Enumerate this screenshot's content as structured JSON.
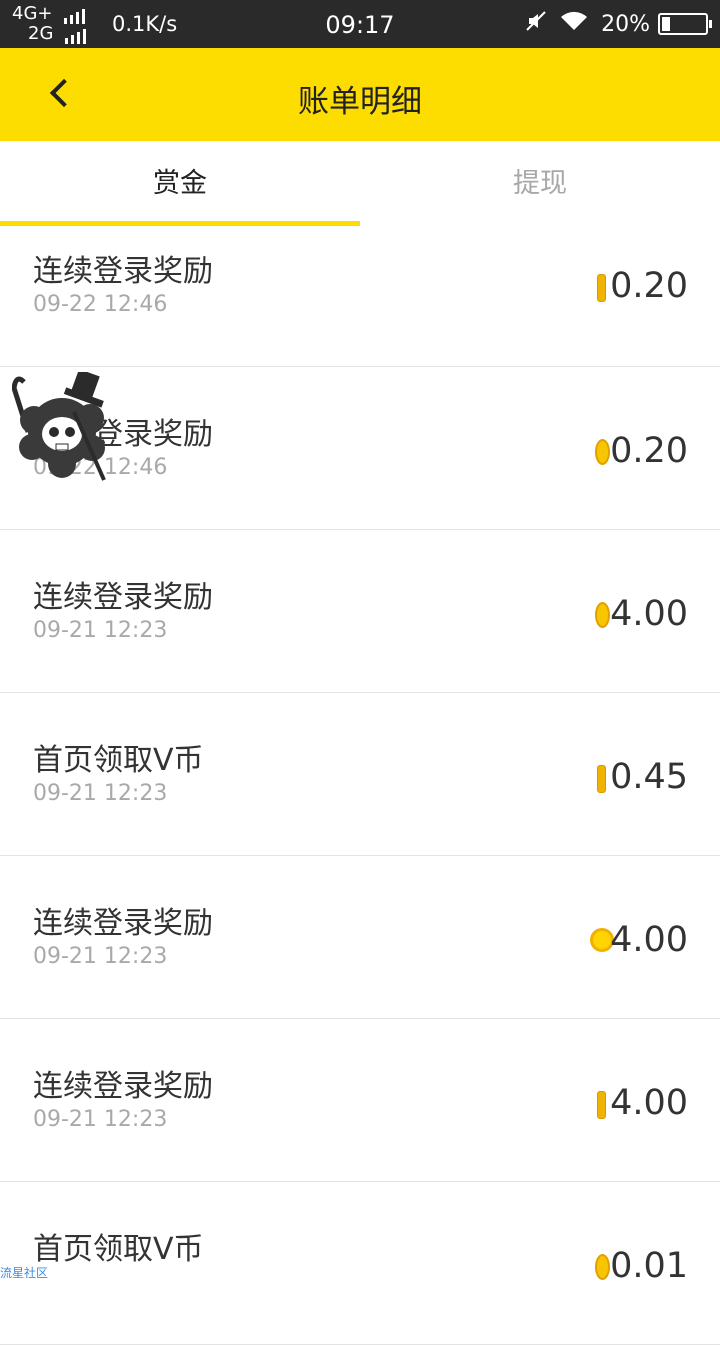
{
  "status_bar": {
    "network_top": "4G+",
    "network_bottom": "2G",
    "speed": "0.1K/s",
    "time": "09:17",
    "battery": "20%",
    "battery_level": 0.2,
    "icons": [
      "signal-icon",
      "mute-icon",
      "wifi-icon",
      "battery-icon"
    ]
  },
  "header": {
    "title": "账单明细",
    "back_icon": "chevron-left-icon",
    "background": "#fddc00"
  },
  "tabs": [
    {
      "label": "赏金",
      "active": true
    },
    {
      "label": "提现",
      "active": false
    }
  ],
  "records": [
    {
      "title": "连续登录奖励",
      "date": "09-22 12:46",
      "amount": "0.20",
      "coin_style": "edge"
    },
    {
      "title": "连续登录奖励",
      "date": "09-22 12:46",
      "amount": "0.20",
      "coin_style": "oval"
    },
    {
      "title": "连续登录奖励",
      "date": "09-21 12:23",
      "amount": "4.00",
      "coin_style": "oval"
    },
    {
      "title": "首页领取V币",
      "date": "09-21 12:23",
      "amount": "0.45",
      "coin_style": "edge"
    },
    {
      "title": "连续登录奖励",
      "date": "09-21 12:23",
      "amount": "4.00",
      "coin_style": "full"
    },
    {
      "title": "连续登录奖励",
      "date": "09-21 12:23",
      "amount": "4.00",
      "coin_style": "edge"
    },
    {
      "title": "首页领取V币",
      "date": "",
      "amount": "0.01",
      "coin_style": "oval"
    }
  ],
  "watermark": "流星社区",
  "colors": {
    "accent": "#fddc00",
    "coin": "#f7c600",
    "text": "#333333",
    "muted": "#a9a9a9"
  }
}
